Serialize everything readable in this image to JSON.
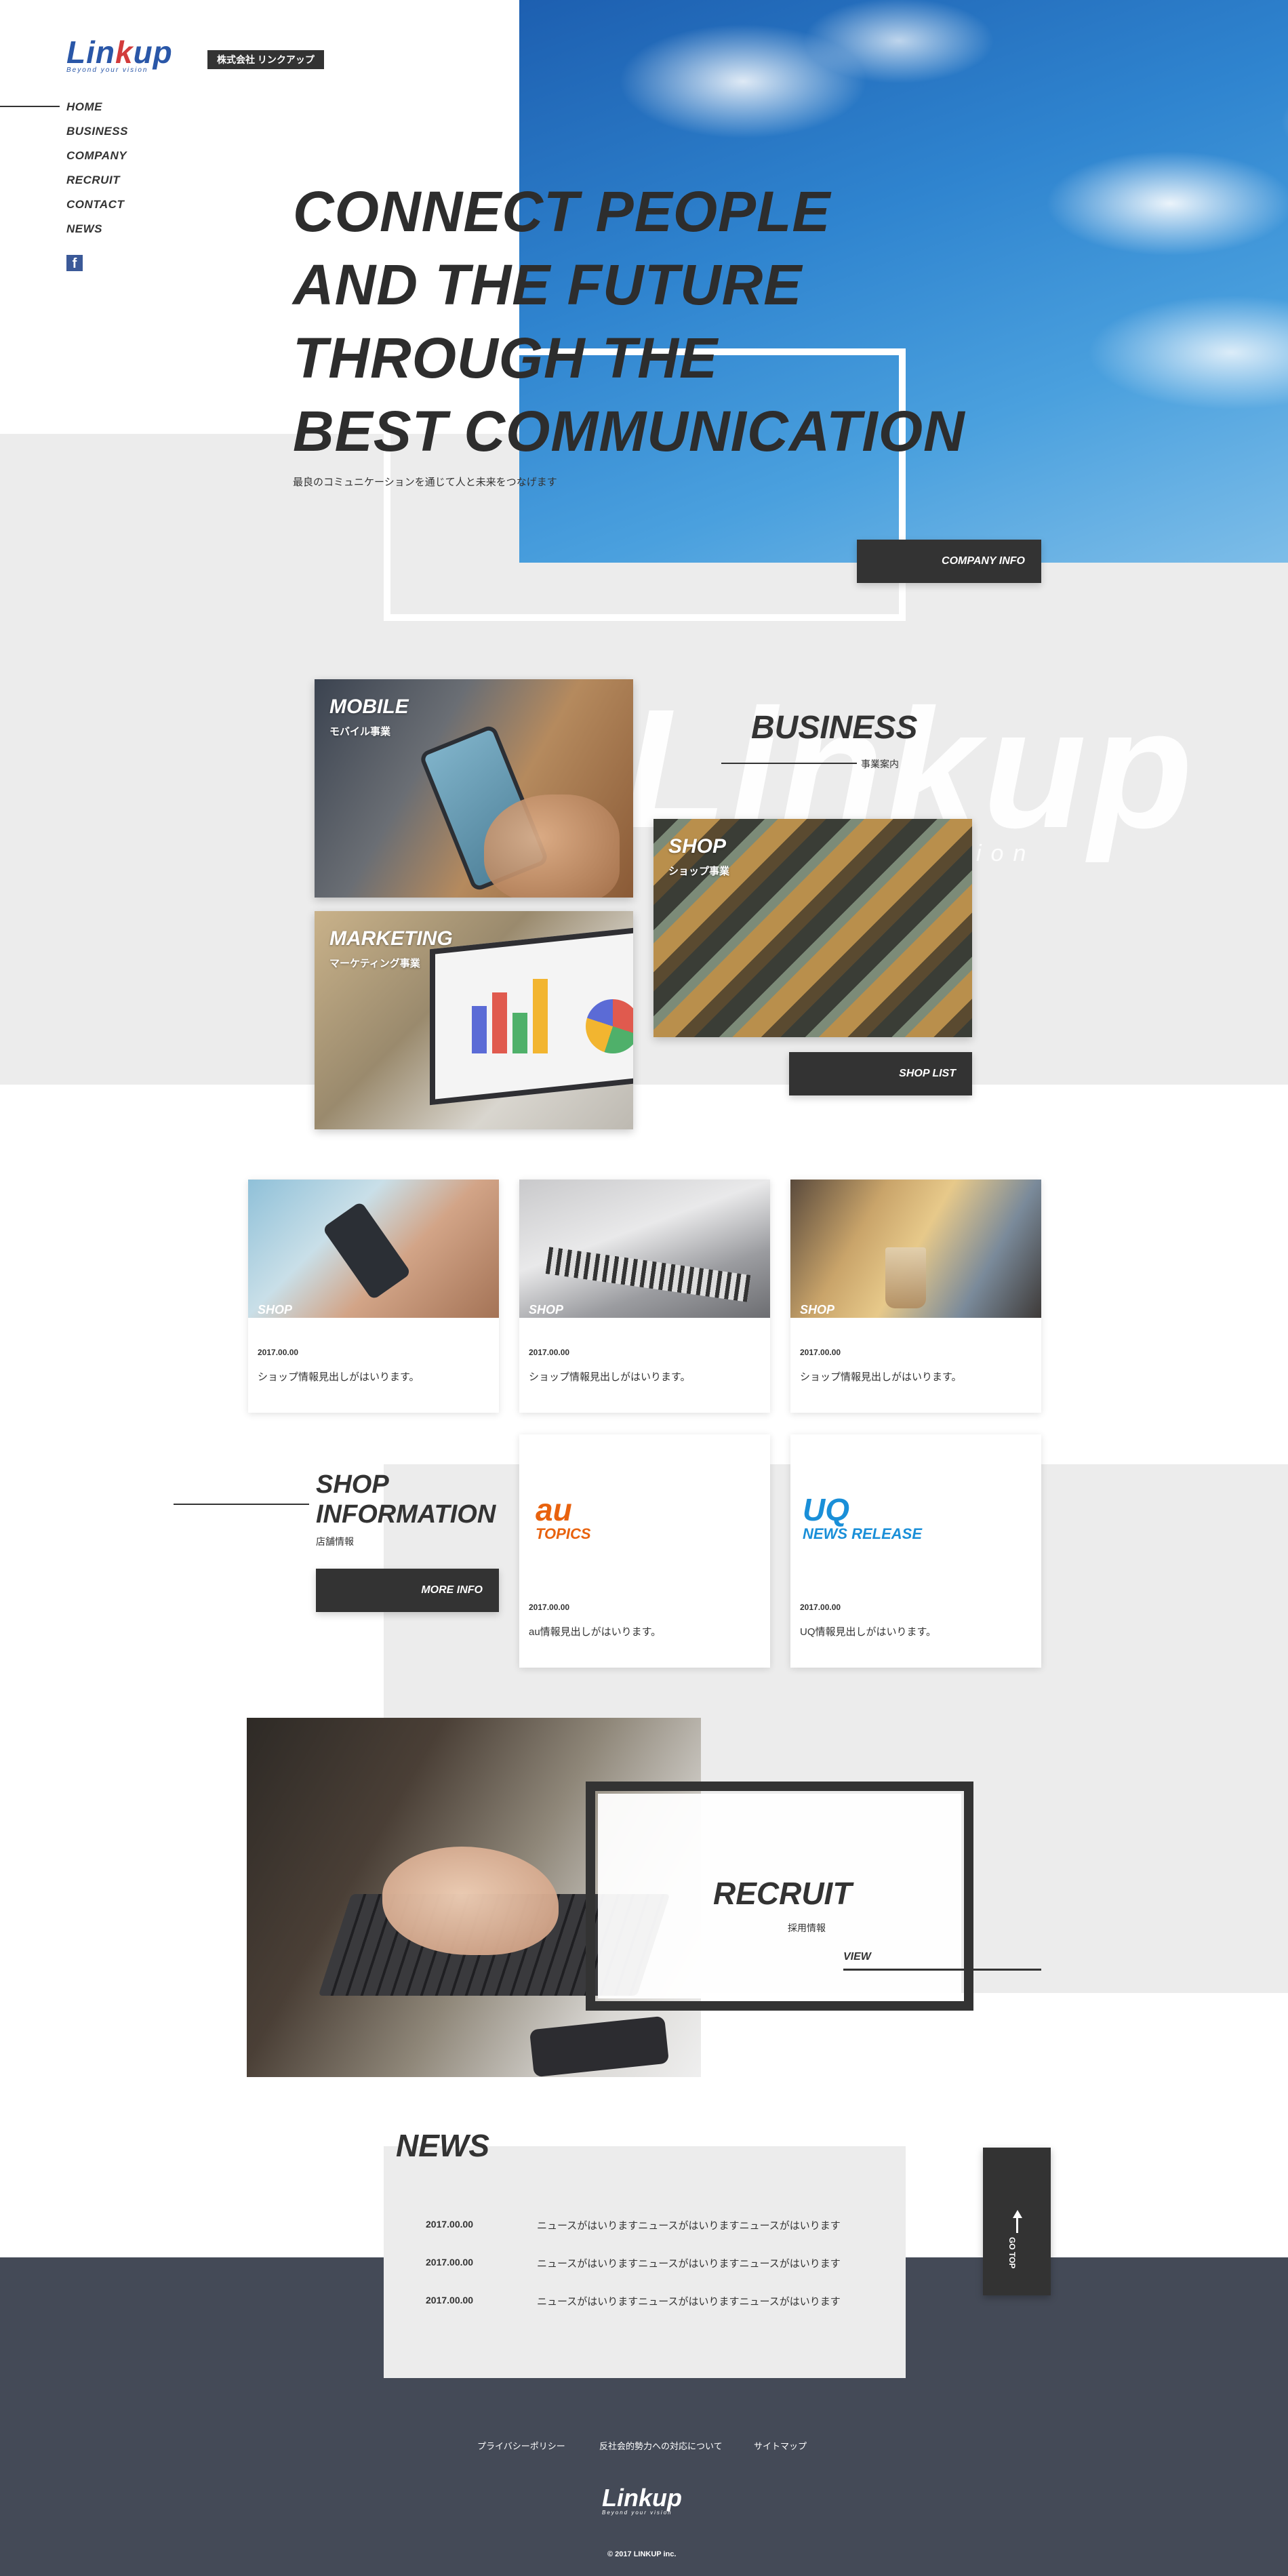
{
  "brand": {
    "logo_main_a": "Lin",
    "logo_main_k": "k",
    "logo_main_b": "up",
    "logo_sub": "Beyond your vision",
    "company_tag": "株式会社 リンクアップ",
    "colors": {
      "logo_blue": "#2a57a8",
      "logo_red": "#d23b3b",
      "dark": "#333333",
      "footer": "#444a57",
      "au_orange": "#e8620e",
      "uq_blue": "#1a8fd8"
    }
  },
  "nav": {
    "items": [
      {
        "label": "HOME"
      },
      {
        "label": "BUSINESS"
      },
      {
        "label": "COMPANY"
      },
      {
        "label": "RECRUIT"
      },
      {
        "label": "CONTACT"
      },
      {
        "label": "NEWS"
      }
    ],
    "social_icon": "facebook-icon",
    "social_glyph": "f"
  },
  "hero": {
    "lines": [
      "CONNECT PEOPLE",
      "AND THE FUTURE",
      "THROUGH THE",
      "BEST COMMUNICATION"
    ],
    "subtitle": "最良のコミュニケーションを通じて人と未来をつなげます",
    "button": "COMPANY INFO"
  },
  "business": {
    "title": "BUSINESS",
    "subtitle": "事業案内",
    "watermark": "Linkup",
    "watermark_sub": "ion",
    "tiles": [
      {
        "title": "MOBILE",
        "sub": "モバイル事業"
      },
      {
        "title": "MARKETING",
        "sub": "マーケティング事業"
      },
      {
        "title": "SHOP",
        "sub": "ショップ事業"
      }
    ],
    "button": "SHOP LIST"
  },
  "shops": {
    "cards": [
      {
        "label": "SHOP",
        "date": "2017.00.00",
        "text": "ショップ情報見出しがはいります。"
      },
      {
        "label": "SHOP",
        "date": "2017.00.00",
        "text": "ショップ情報見出しがはいります。"
      },
      {
        "label": "SHOP",
        "date": "2017.00.00",
        "text": "ショップ情報見出しがはいります。"
      }
    ]
  },
  "shop_info": {
    "title_line1": "SHOP",
    "title_line2": "INFORMATION",
    "subtitle": "店舗情報",
    "button": "MORE INFO",
    "au": {
      "brand": "au",
      "label": "TOPICS",
      "date": "2017.00.00",
      "text": "au情報見出しがはいります。"
    },
    "uq": {
      "brand": "UQ",
      "label": "NEWS RELEASE",
      "date": "2017.00.00",
      "text": "UQ情報見出しがはいります。"
    }
  },
  "recruit": {
    "title": "RECRUIT",
    "subtitle": "採用情報",
    "link": "VIEW"
  },
  "news": {
    "title": "NEWS",
    "items": [
      {
        "date": "2017.00.00",
        "text": "ニュースがはいりますニュースがはいりますニュースがはいります"
      },
      {
        "date": "2017.00.00",
        "text": "ニュースがはいりますニュースがはいりますニュースがはいります"
      },
      {
        "date": "2017.00.00",
        "text": "ニュースがはいりますニュースがはいりますニュースがはいります"
      }
    ]
  },
  "go_top": {
    "label": "GO TOP",
    "icon": "arrow-up-icon"
  },
  "footer": {
    "links": [
      "プライバシーポリシー",
      "反社会的勢力への対応について",
      "サイトマップ"
    ],
    "copyright": "© 2017 LINKUP inc."
  }
}
